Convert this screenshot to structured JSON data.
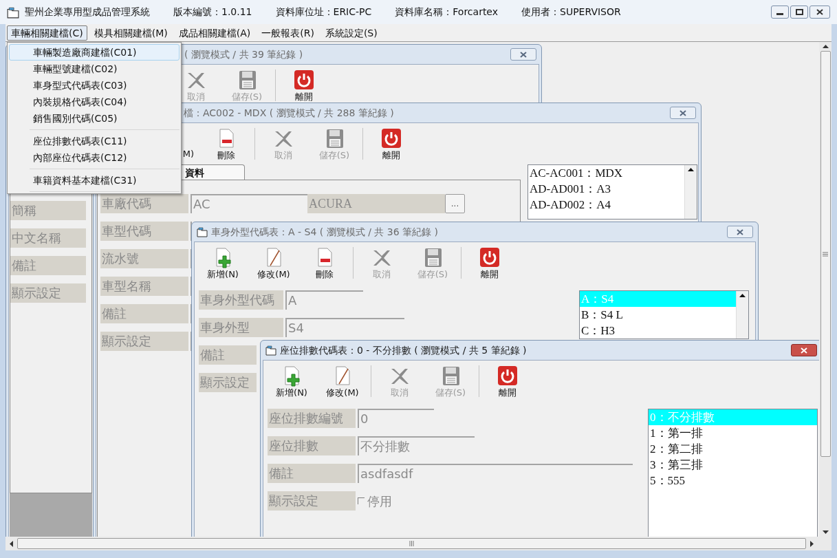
{
  "app": {
    "title": "聖州企業專用型成品管理系統",
    "version": "版本編號：1.0.11",
    "database_location": "資料庫位址：ERIC-PC",
    "database_name": "資料庫名稱：Forcartex",
    "user": "使用者：SUPERVISOR"
  },
  "menu": [
    {
      "label": "車輛相關建檔(C)",
      "selected": true
    },
    {
      "label": "模具相關建檔(M)",
      "selected": false
    },
    {
      "label": "成品相關建檔(A)",
      "selected": false
    },
    {
      "label": "一般報表(R)",
      "selected": false
    },
    {
      "label": "系統設定(S)",
      "selected": false
    }
  ],
  "dropdown": [
    [
      {
        "label": "車輛製造廠商建檔(C01)",
        "selected": true
      },
      {
        "label": "車輛型號建檔(C02)",
        "selected": false
      },
      {
        "label": "車身型式代碼表(C03)",
        "selected": false
      },
      {
        "label": "內裝規格代碼表(C04)",
        "selected": false
      },
      {
        "label": "銷售國別代碼(C05)",
        "selected": false
      }
    ],
    [
      {
        "label": "座位排數代碼表(C11)",
        "selected": false
      },
      {
        "label": "內部座位代碼表(C12)",
        "selected": false
      }
    ],
    [
      {
        "label": "車籍資料基本建檔(C31)",
        "selected": false
      }
    ]
  ],
  "windows": [
    {
      "title": "( 瀏覽模式 / 共 39 筆紀錄 )",
      "active": false,
      "toolbar": [
        [
          {
            "kind": "cancel",
            "label": "取消",
            "disabled": true
          },
          {
            "kind": "save",
            "label": "儲存(S)",
            "disabled": true
          }
        ],
        [
          {
            "kind": "exit",
            "label": "離開",
            "disabled": false
          }
        ]
      ],
      "labels": [
        "簡稱",
        "中文名稱",
        "備註",
        "顯示設定"
      ]
    },
    {
      "title": "檔：AC002 - MDX ( 瀏覽模式 / 共 288 筆紀錄 )",
      "active": false,
      "toolbar": [
        [
          {
            "kind": "fragment",
            "label": "M)"
          },
          {
            "kind": "delete",
            "label": "刪除",
            "disabled": false
          }
        ],
        [
          {
            "kind": "cancel",
            "label": "取消",
            "disabled": true
          },
          {
            "kind": "save",
            "label": "儲存(S)",
            "disabled": true
          }
        ],
        [
          {
            "kind": "exit",
            "label": "離開",
            "disabled": false
          }
        ]
      ],
      "tab": {
        "label": "資料",
        "selected": true
      },
      "fields": [
        {
          "label": "車廠代碼",
          "kind": "lookup",
          "value": "AC",
          "name": "ACURA",
          "button": "..."
        },
        {
          "label": "車型代碼",
          "kind": "text"
        },
        {
          "label": "流水號",
          "kind": "text"
        },
        {
          "label": "車型名稱",
          "kind": "text"
        },
        {
          "label": "備註",
          "kind": "text"
        },
        {
          "label": "顯示設定",
          "kind": "text"
        }
      ],
      "list": [
        {
          "label": "AC-AC001：MDX",
          "selected": false
        },
        {
          "label": "AD-AD001：A3",
          "selected": false
        },
        {
          "label": "AD-AD002：A4",
          "selected": false
        }
      ]
    },
    {
      "title": "車身外型代碼表：A - S4 ( 瀏覽模式 / 共 36 筆紀錄 )",
      "active": false,
      "toolbar": [
        [
          {
            "kind": "new",
            "label": "新增(N)",
            "disabled": false
          },
          {
            "kind": "edit",
            "label": "修改(M)",
            "disabled": false
          },
          {
            "kind": "delete",
            "label": "刪除",
            "disabled": false
          }
        ],
        [
          {
            "kind": "cancel",
            "label": "取消",
            "disabled": true
          },
          {
            "kind": "save",
            "label": "儲存(S)",
            "disabled": true
          }
        ],
        [
          {
            "kind": "exit",
            "label": "離開",
            "disabled": false
          }
        ]
      ],
      "fields": [
        {
          "label": "車身外型代碼",
          "kind": "text",
          "value": "A"
        },
        {
          "label": "車身外型",
          "kind": "text",
          "value": "S4"
        },
        {
          "label": "備註",
          "kind": "text"
        },
        {
          "label": "顯示設定",
          "kind": "text"
        }
      ],
      "list": [
        {
          "label": "A：S4",
          "selected": true
        },
        {
          "label": "B：S4 L",
          "selected": false
        },
        {
          "label": "C：H3",
          "selected": false
        }
      ]
    },
    {
      "title": "座位排數代碼表：0 - 不分排數 ( 瀏覽模式 / 共 5 筆紀錄 )",
      "active": true,
      "toolbar": [
        [
          {
            "kind": "new",
            "label": "新增(N)",
            "disabled": false
          },
          {
            "kind": "edit",
            "label": "修改(M)",
            "disabled": false
          }
        ],
        [
          {
            "kind": "cancel",
            "label": "取消",
            "disabled": true
          },
          {
            "kind": "save",
            "label": "儲存(S)",
            "disabled": true
          }
        ],
        [
          {
            "kind": "exit",
            "label": "離開",
            "disabled": false
          }
        ]
      ],
      "fields": [
        {
          "label": "座位排數編號",
          "kind": "text",
          "value": "0"
        },
        {
          "label": "座位排數",
          "kind": "text",
          "value": "不分排數"
        },
        {
          "label": "備註",
          "kind": "text",
          "value": "asdfasdf"
        },
        {
          "label": "顯示設定",
          "kind": "checkbox",
          "checked": false,
          "option": "停用"
        }
      ],
      "list": [
        {
          "label": "0：不分排數",
          "selected": true
        },
        {
          "label": "1：第一排",
          "selected": false
        },
        {
          "label": "2：第二排",
          "selected": false
        },
        {
          "label": "3：第三排",
          "selected": false
        },
        {
          "label": "5：555",
          "selected": false
        }
      ]
    }
  ]
}
